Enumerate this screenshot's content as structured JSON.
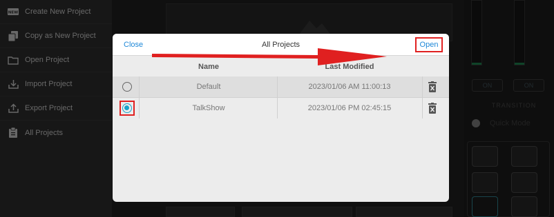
{
  "sidebar": {
    "items": [
      {
        "label": "Create New Project",
        "icon": "new-badge-icon"
      },
      {
        "label": "Copy as New Project",
        "icon": "copy-icon"
      },
      {
        "label": "Open Project",
        "icon": "folder-icon"
      },
      {
        "label": "Import Project",
        "icon": "import-icon"
      },
      {
        "label": "Export Project",
        "icon": "export-icon"
      },
      {
        "label": "All Projects",
        "icon": "clipboard-icon"
      }
    ],
    "new_badge": "NEW"
  },
  "background": {
    "on_left": "ON",
    "on_right": "ON",
    "transition_label": "TRANSITION",
    "quick_mode_label": "Quick Mode"
  },
  "modal": {
    "title": "All Projects",
    "close_label": "Close",
    "open_label": "Open",
    "columns": {
      "name": "Name",
      "last_modified": "Last Modified"
    },
    "rows": [
      {
        "name": "Default",
        "last_modified": "2023/01/06 AM 11:00:13",
        "selected": false
      },
      {
        "name": "TalkShow",
        "last_modified": "2023/01/06 PM 02:45:15",
        "selected": true
      }
    ]
  },
  "colors": {
    "accent": "#1e88d8",
    "radio_selected": "#19a3c9",
    "annotation_red": "#e02020"
  }
}
